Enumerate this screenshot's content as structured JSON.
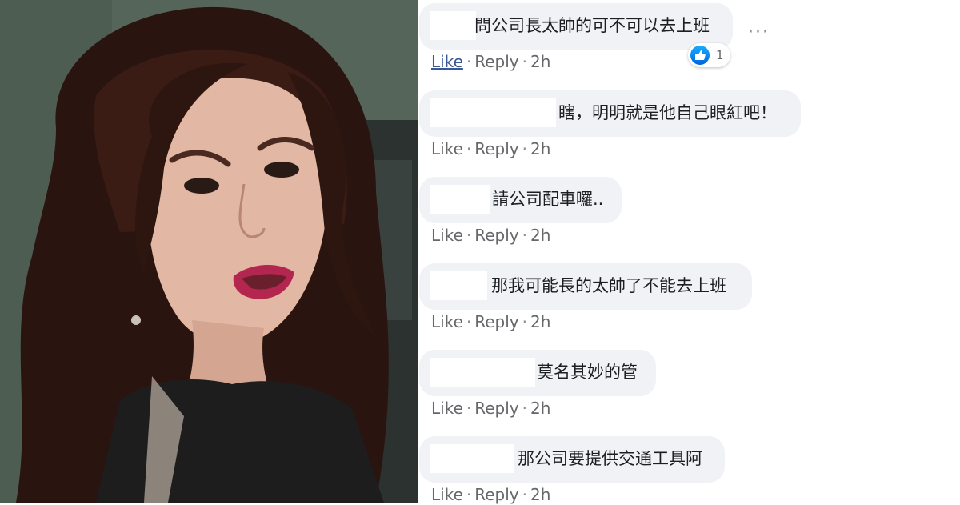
{
  "colors": {
    "bubble_bg": "#f0f2f5",
    "link_blue": "#385898",
    "meta_gray": "#65676b",
    "like_blue": "#1877f2"
  },
  "photo": {
    "icon": "woman-portrait-image"
  },
  "comments": [
    {
      "text": "問公司長太帥的可不可以去上班",
      "like": "Like",
      "reply": "Reply",
      "time": "2h",
      "reaction_count": "1",
      "more": "···"
    },
    {
      "text": "瞎，明明就是他自己眼紅吧！",
      "like": "Like",
      "reply": "Reply",
      "time": "2h"
    },
    {
      "text": "請公司配車囉..",
      "like": "Like",
      "reply": "Reply",
      "time": "2h"
    },
    {
      "text": "那我可能長的太帥了不能去上班",
      "like": "Like",
      "reply": "Reply",
      "time": "2h"
    },
    {
      "text": "莫名其妙的管",
      "like": "Like",
      "reply": "Reply",
      "time": "2h"
    },
    {
      "text": "那公司要提供交通工具阿",
      "like": "Like",
      "reply": "Reply",
      "time": "2h"
    }
  ]
}
